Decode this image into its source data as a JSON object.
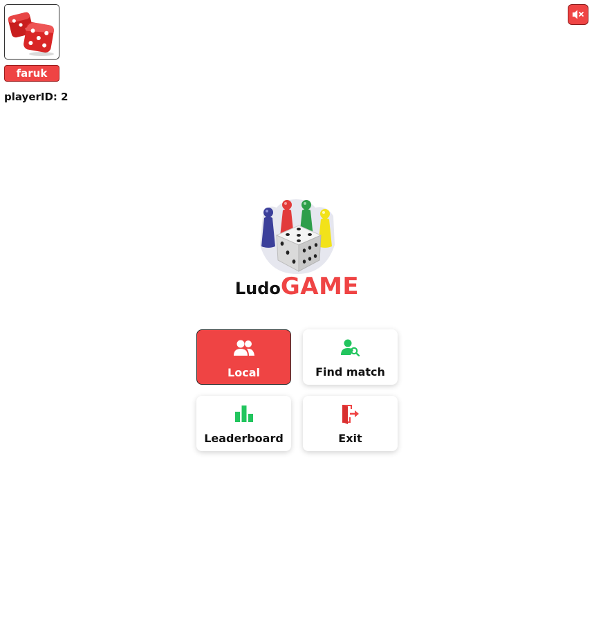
{
  "player": {
    "name": "faruk",
    "id_label": "playerID:",
    "id_value": "2",
    "avatar_icon": "red-dice-icon"
  },
  "sound": {
    "icon": "speaker-muted-icon"
  },
  "logo": {
    "word1": "Ludo",
    "word2": "GAME",
    "art_icon": "ludo-pawns-and-dice-icon"
  },
  "menu": {
    "local": {
      "label": "Local",
      "icon": "users-icon"
    },
    "find_match": {
      "label": "Find match",
      "icon": "user-search-icon"
    },
    "leaderboard": {
      "label": "Leaderboard",
      "icon": "bar-chart-icon"
    },
    "exit": {
      "label": "Exit",
      "icon": "exit-door-icon"
    }
  },
  "colors": {
    "accent": "#ef4444",
    "green": "#22c55e",
    "pawn_blue": "#3b3f9a",
    "pawn_red": "#e23b3b",
    "pawn_green": "#2e9e4a",
    "pawn_yellow": "#f2e21a"
  }
}
